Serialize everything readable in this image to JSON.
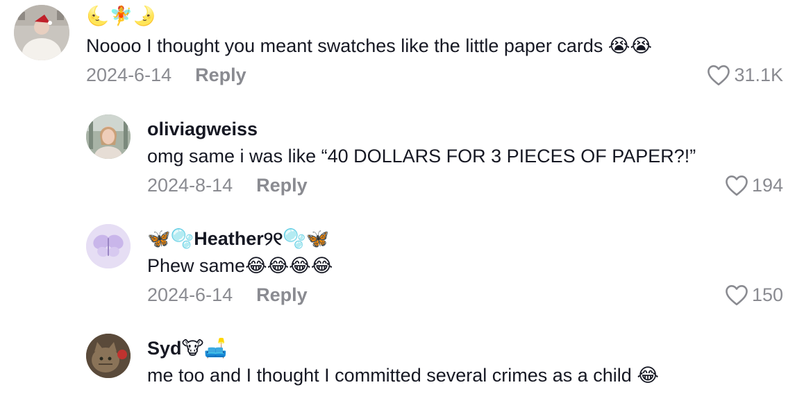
{
  "comments": [
    {
      "username": "🌜🧚🌛",
      "text": "Noooo I thought you meant swatches like the little paper cards 😭😭",
      "date": "2024-6-14",
      "reply_label": "Reply",
      "likes": "31.1K",
      "avatar_icon": "avatar-icon"
    },
    {
      "username": "oliviagweiss",
      "text": "omg same i was like “40 DOLLARS FOR 3 PIECES OF PAPER?!”",
      "date": "2024-8-14",
      "reply_label": "Reply",
      "likes": "194",
      "avatar_icon": "avatar-icon"
    },
    {
      "username": "🦋🫧Heather୨୧🫧🦋",
      "text": "Phew same😂😂😂😂",
      "date": "2024-6-14",
      "reply_label": "Reply",
      "likes": "150",
      "avatar_icon": "butterfly-icon"
    },
    {
      "username": "Syd🐮🛋️",
      "text": "me too and I thought I committed several crimes as a child 😂",
      "avatar_icon": "cat-icon"
    }
  ],
  "colors": {
    "text": "#161823",
    "muted": "#8a8b91",
    "heart_outline": "#8a8b91"
  },
  "icons": {
    "like": "heart-outline-icon"
  }
}
